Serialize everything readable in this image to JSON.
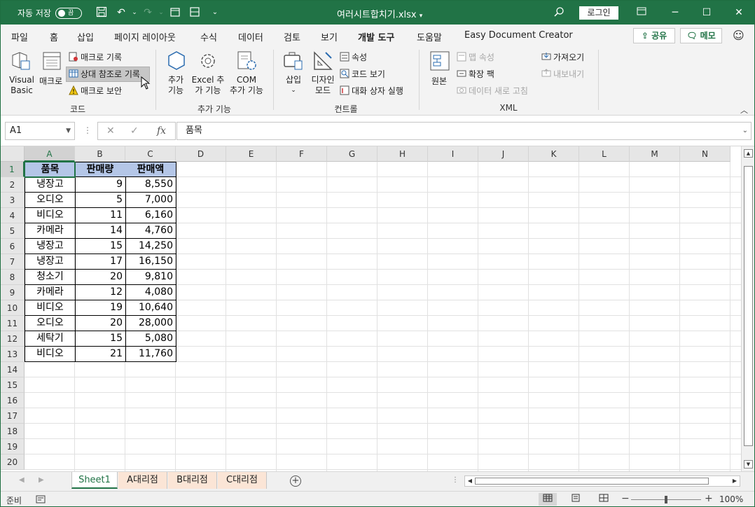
{
  "titlebar": {
    "autosave_label": "자동 저장",
    "autosave_state": "끔",
    "filename": "여러시트합치기.xlsx",
    "login": "로그인"
  },
  "menu": {
    "tabs": [
      "파일",
      "홈",
      "삽입",
      "페이지 레이아웃",
      "수식",
      "데이터",
      "검토",
      "보기",
      "개발 도구",
      "도움말",
      "Easy Document Creator"
    ],
    "active": "개발 도구",
    "share": "공유",
    "memo": "메모"
  },
  "ribbon": {
    "code": {
      "visual_basic": [
        "Visual",
        "Basic"
      ],
      "macro": "매크로",
      "record_macro": "매크로 기록",
      "relative_ref": "상대 참조로 기록",
      "macro_security": "매크로 보안",
      "label": "코드"
    },
    "addins": {
      "addins": [
        "추가",
        "기능"
      ],
      "excel_addins": [
        "Excel 추",
        "가 기능"
      ],
      "com_addins": [
        "COM",
        "추가 기능"
      ],
      "label": "추가 기능"
    },
    "controls": {
      "insert": "삽입",
      "design_mode": [
        "디자인",
        "모드"
      ],
      "properties": "속성",
      "view_code": "코드 보기",
      "run_dialog": "대화 상자 실행",
      "label": "컨트롤"
    },
    "xml": {
      "source": "원본",
      "map_properties": "맵 속성",
      "expansion_packs": "확장 팩",
      "refresh_data": "데이터 새로 고침",
      "import": "가져오기",
      "export": "내보내기",
      "label": "XML"
    }
  },
  "formula": {
    "namebox": "A1",
    "content": "품목"
  },
  "grid": {
    "columns": [
      "A",
      "B",
      "C",
      "D",
      "E",
      "F",
      "G",
      "H",
      "I",
      "J",
      "K",
      "L",
      "M",
      "N"
    ],
    "rows": [
      "1",
      "2",
      "3",
      "4",
      "5",
      "6",
      "7",
      "8",
      "9",
      "10",
      "11",
      "12",
      "13",
      "14",
      "15",
      "16",
      "17",
      "18",
      "19",
      "20"
    ],
    "headers": [
      "품목",
      "판매량",
      "판매액"
    ],
    "data": [
      [
        "냉장고",
        "9",
        "8,550"
      ],
      [
        "오디오",
        "5",
        "7,000"
      ],
      [
        "비디오",
        "11",
        "6,160"
      ],
      [
        "카메라",
        "14",
        "4,760"
      ],
      [
        "냉장고",
        "15",
        "14,250"
      ],
      [
        "냉장고",
        "17",
        "16,150"
      ],
      [
        "청소기",
        "20",
        "9,810"
      ],
      [
        "카메라",
        "12",
        "4,080"
      ],
      [
        "비디오",
        "19",
        "10,640"
      ],
      [
        "오디오",
        "20",
        "28,000"
      ],
      [
        "세탁기",
        "15",
        "5,080"
      ],
      [
        "비디오",
        "21",
        "11,760"
      ]
    ]
  },
  "sheets": {
    "tabs": [
      "Sheet1",
      "A대리점",
      "B대리점",
      "C대리점"
    ],
    "active": "Sheet1"
  },
  "status": {
    "text": "준비",
    "zoom": "100%"
  },
  "colors": {
    "accent": "#217346",
    "header_fill": "#b4c6e7",
    "tab_orange": "#fbe5d6"
  }
}
